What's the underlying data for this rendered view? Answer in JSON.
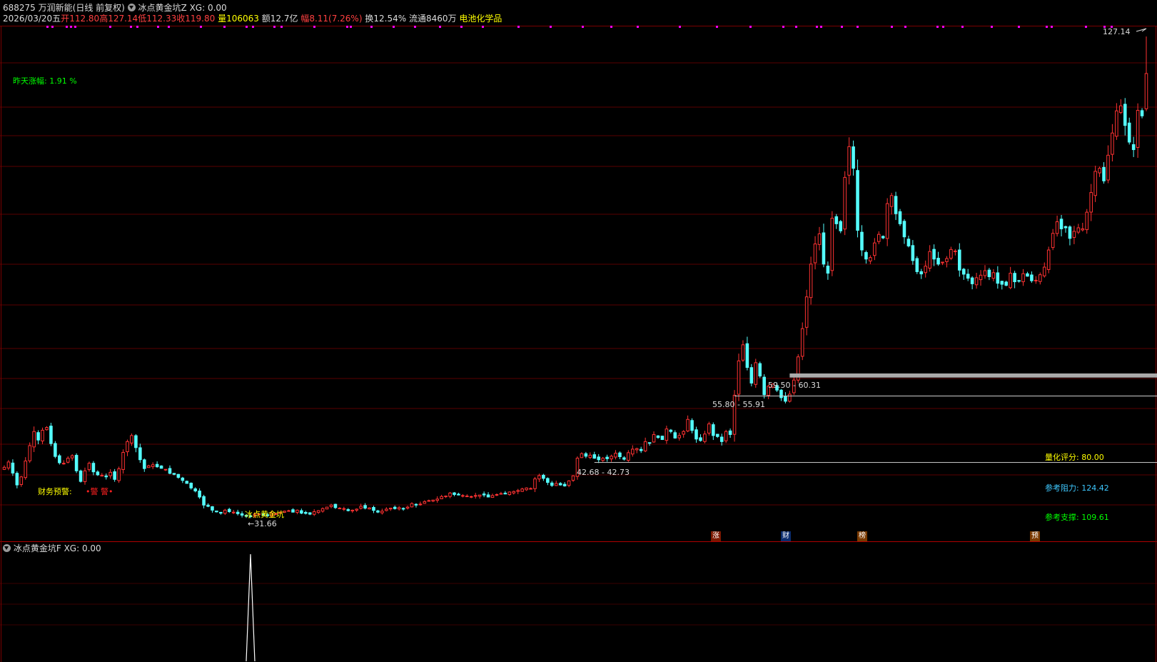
{
  "header": {
    "stock_code": "688275",
    "stock_name": "万润新能",
    "period_label": "(日线 前复权)",
    "indicator_main": "冰点黄金坑Z",
    "indicator_main_xg": "XG: 0.00",
    "date": "2026/03/20五",
    "open_label": "开",
    "open_value": "112.80",
    "high_label": "高",
    "high_value": "127.14",
    "low_label": "低",
    "low_value": "112.33",
    "close_label": "收",
    "close_value": "119.80",
    "volume_label": "量",
    "volume_value": "106063",
    "amount_label": "额",
    "amount_value": "12.7亿",
    "change_label": "幅",
    "change_value": "8.11(7.26%)",
    "turnover_label": "换",
    "turnover_value": "12.54%",
    "float_label": "流通",
    "float_value": "8460万",
    "sector": "电池化学品"
  },
  "overlay": {
    "yesterday_change": "昨天涨幅: 1.91 %",
    "finance_warning_label": "财务预警:",
    "finance_warning_value": "•警 警•",
    "signal_label": "冰点黄金坑",
    "low_marker": "←31.66",
    "high_marker": "127.14",
    "zone_1": "42.68 - 42.73",
    "zone_2": "55.80 - 55.91",
    "zone_3": "59.50 - 60.31",
    "score": "量化评分: 80.00",
    "resistance": "参考阻力: 124.42",
    "support": "参考支撑: 109.61",
    "event_tags": [
      "涨",
      "财",
      "榜",
      "预"
    ]
  },
  "sub_panel": {
    "indicator": "冰点黄金坑F",
    "xg": "XG: 0.00"
  },
  "colors": {
    "up": "#ff3232",
    "down": "#54ffff",
    "label_yellow": "#ffff00",
    "label_green": "#00ff00",
    "label_cyan": "#3ec8ff",
    "magenta": "#ff00ff",
    "grid": "#5a0000"
  },
  "chart_data": {
    "type": "candlestick",
    "price_range": [
      29,
      129
    ],
    "signal_index": 58,
    "zones": [
      {
        "from": 42.68,
        "to": 42.73,
        "start_index": 139
      },
      {
        "from": 55.8,
        "to": 55.91,
        "start_index": 172
      },
      {
        "from": 59.5,
        "to": 60.31,
        "start_index": 185
      }
    ],
    "closes": [
      41.7,
      42.75,
      40.55,
      38.2,
      39.8,
      42.95,
      46.0,
      48.8,
      47.1,
      49.05,
      49.6,
      46.4,
      43.85,
      42.6,
      42.5,
      43.5,
      44.0,
      41.0,
      38.9,
      41.0,
      42.5,
      40.8,
      40.2,
      40.1,
      39.8,
      40.7,
      39.3,
      41.4,
      44.65,
      46.8,
      48.0,
      45.6,
      43.2,
      41.45,
      42.0,
      42.2,
      41.8,
      41.5,
      41.3,
      40.5,
      40.3,
      39.7,
      39.1,
      38.5,
      37.6,
      37.0,
      35.8,
      34.2,
      33.95,
      33.2,
      32.85,
      32.6,
      33.2,
      32.9,
      32.8,
      32.5,
      32.2,
      32.0,
      31.9,
      32.4,
      32.45,
      32.2,
      32.1,
      32.6,
      32.5,
      32.7,
      33.0,
      33.1,
      32.8,
      33.2,
      32.6,
      32.55,
      32.4,
      32.9,
      33.1,
      33.5,
      33.8,
      34.2,
      33.7,
      33.6,
      33.5,
      33.1,
      33.2,
      33.4,
      33.95,
      33.6,
      33.65,
      33.15,
      32.8,
      33.0,
      33.4,
      33.6,
      33.5,
      33.7,
      33.5,
      33.8,
      34.5,
      34.2,
      34.4,
      34.9,
      35.1,
      35.2,
      35.4,
      35.9,
      36.0,
      36.6,
      36.3,
      36.2,
      36.1,
      36.0,
      35.9,
      36.1,
      36.2,
      36.2,
      35.8,
      36.1,
      36.3,
      36.5,
      36.4,
      36.8,
      36.9,
      37.1,
      37.4,
      37.6,
      37.5,
      39.4,
      40.05,
      39.5,
      38.7,
      38.1,
      38.5,
      38.2,
      38.0,
      39.0,
      40.0,
      43.5,
      44.4,
      43.9,
      44.1,
      43.5,
      43.2,
      43.5,
      43.4,
      43.9,
      44.5,
      43.8,
      43.3,
      44.6,
      45.3,
      45.4,
      45.0,
      46.8,
      46.5,
      48.2,
      47.6,
      47.2,
      49.3,
      48.8,
      47.5,
      48.0,
      48.8,
      51.2,
      49.0,
      47.3,
      47.0,
      48.3,
      50.3,
      48.0,
      47.8,
      46.8,
      48.8,
      48.2,
      56.0,
      62.8,
      66.0,
      61.5,
      58.4,
      62.45,
      59.8,
      56.1,
      57.8,
      58.2,
      57.0,
      55.5,
      54.8,
      56.2,
      59.0,
      63.6,
      69.2,
      75.5,
      82.0,
      86.0,
      88.0,
      82.0,
      80.2,
      91.1,
      90.0,
      88.6,
      99.2,
      105.3,
      101.0,
      88.7,
      84.8,
      83.0,
      83.3,
      86.2,
      87.9,
      87.2,
      94.0,
      95.6,
      92.0,
      90.0,
      87.4,
      85.6,
      82.7,
      80.5,
      80.05,
      81.6,
      84.5,
      83.0,
      82.0,
      82.4,
      83.1,
      84.9,
      84.6,
      80.8,
      80.0,
      79.2,
      78.1,
      79.3,
      79.8,
      80.7,
      79.5,
      80.3,
      78.2,
      78.0,
      77.8,
      80.2,
      78.5,
      78.7,
      80.1,
      79.6,
      78.7,
      78.8,
      79.9,
      81.4,
      84.8,
      88.1,
      90.4,
      89.0,
      89.2,
      87.1,
      88.5,
      89.2,
      89.0,
      92.3,
      96.2,
      100.4,
      101.0,
      98.5,
      103.6,
      108.0,
      112.4,
      113.4,
      109.5,
      106.2,
      104.7,
      112.5,
      111.4,
      119.8
    ]
  }
}
